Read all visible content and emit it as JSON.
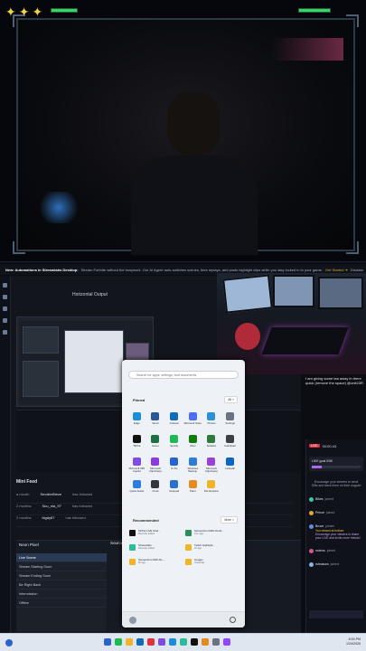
{
  "banner": {
    "title": "New: Automations in Streamlabs Desktop:",
    "text": "Stream Fortnite without the busywork. Our AI Agent auto-switches scenes, fires replays, and posts highlight clips while you stay locked in to your game.",
    "link": "Get Started ➜",
    "dismiss": "Dismiss"
  },
  "obs": {
    "preview_title": "Horizontal Output",
    "mini_feed": {
      "title": "Mini Feed",
      "rows": [
        {
          "time": "a month",
          "name": "SmokinSteve",
          "action": "has followed"
        },
        {
          "time": "2 months",
          "name": "Suu_nia_97",
          "action": "has followed"
        },
        {
          "time": "2 months",
          "name": "bigdy87",
          "action": "has followed"
        }
      ]
    },
    "scenes_dock": "Neon Pixel",
    "sources_dock": "Sources",
    "scenes": [
      "Live Scene",
      "Stream Starting Soon",
      "Stream Ending Soon",
      "Be Right Back",
      "Intermission",
      "Offline"
    ]
  },
  "caption_text": "I am giving some tea away in there quick (remove the space) @unit23R",
  "start_menu": {
    "search_placeholder": "Search for apps, settings, and documents",
    "pinned_label": "Pinned",
    "all_label": "All >",
    "recommended_label": "Recommended",
    "more_label": "More >",
    "pinned": [
      {
        "label": "Edge",
        "color": "#1a8fd8"
      },
      {
        "label": "Word",
        "color": "#2b5797"
      },
      {
        "label": "Outlook",
        "color": "#0f6cbd"
      },
      {
        "label": "Microsoft Store",
        "color": "#4e6ef2"
      },
      {
        "label": "Photos",
        "color": "#2e8fd9"
      },
      {
        "label": "Settings",
        "color": "#6b7280"
      },
      {
        "label": "TikTok",
        "color": "#111111"
      },
      {
        "label": "Excel",
        "color": "#1d7044"
      },
      {
        "label": "Spotify",
        "color": "#1db954"
      },
      {
        "label": "Xbox",
        "color": "#107c10"
      },
      {
        "label": "Solitaire",
        "color": "#2f7a3a"
      },
      {
        "label": "Calculator",
        "color": "#3b3f46"
      },
      {
        "label": "Microsoft 365 Copilot",
        "color": "#7b4de0"
      },
      {
        "label": "Microsoft Clipchamp",
        "color": "#8b3ae0"
      },
      {
        "label": "To Do",
        "color": "#2564cf"
      },
      {
        "label": "Windows Backup",
        "color": "#2f7bd6"
      },
      {
        "label": "Microsoft Clipchamp",
        "color": "#9b40d8"
      },
      {
        "label": "LinkedIn",
        "color": "#0a66c2"
      },
      {
        "label": "Quick Assist",
        "color": "#2b7de0"
      },
      {
        "label": "Clock",
        "color": "#33373e"
      },
      {
        "label": "Notepad",
        "color": "#2a70d0"
      },
      {
        "label": "Paint",
        "color": "#e58a1f"
      },
      {
        "label": "File Explorer",
        "color": "#f0b429"
      }
    ],
    "recommended": [
      {
        "title": "TikTok LIVE Stud...",
        "sub": "Recently added",
        "color": "#111111"
      },
      {
        "title": "Screenshot 2026-01-24...",
        "sub": "11m ago",
        "color": "#2a8f5a"
      },
      {
        "title": "Streamlabs",
        "sub": "Recently added",
        "color": "#2bbd9a"
      },
      {
        "title": "Twitch Highlight...",
        "sub": "2h ago",
        "color": "#f0b429"
      },
      {
        "title": "Screenshot 2026-01-...",
        "sub": "5h ago",
        "color": "#f0b429"
      },
      {
        "title": "Images",
        "sub": "Yesterday",
        "color": "#f0b429"
      }
    ]
  },
  "chat": {
    "time": "00:00:43",
    "live_badge": "LIVE",
    "goal": "LIKE goal 0/50",
    "empty_message": "Encourage your viewers to send Gifts and track them on their support",
    "events": [
      {
        "user": "Bikes",
        "text": "joined",
        "color": "#3ec5a4"
      },
      {
        "user": "Prince",
        "text": "joined",
        "color": "#e0a53b"
      },
      {
        "user": "Bruce",
        "text": "joined",
        "color": "#5b8fe0"
      },
      {
        "user": "rodeos",
        "text": "joined",
        "color": "#d05a8a"
      }
    ],
    "notice": "You viewed at bottom",
    "note2": "Encourage your viewers to share your LIVE and invite more friends!",
    "last_user": "ruleasura",
    "last_text": "joined"
  },
  "taskbar": {
    "time": "8:00 PM",
    "date": "1/24/2026",
    "icons": [
      "#2a64c8",
      "#1db954",
      "#f0b429",
      "#0f6cbd",
      "#e0303c",
      "#7b4de0",
      "#1a8fd8",
      "#2bbd9a",
      "#111111",
      "#e58a1f",
      "#6b7280",
      "#9146ff"
    ]
  }
}
